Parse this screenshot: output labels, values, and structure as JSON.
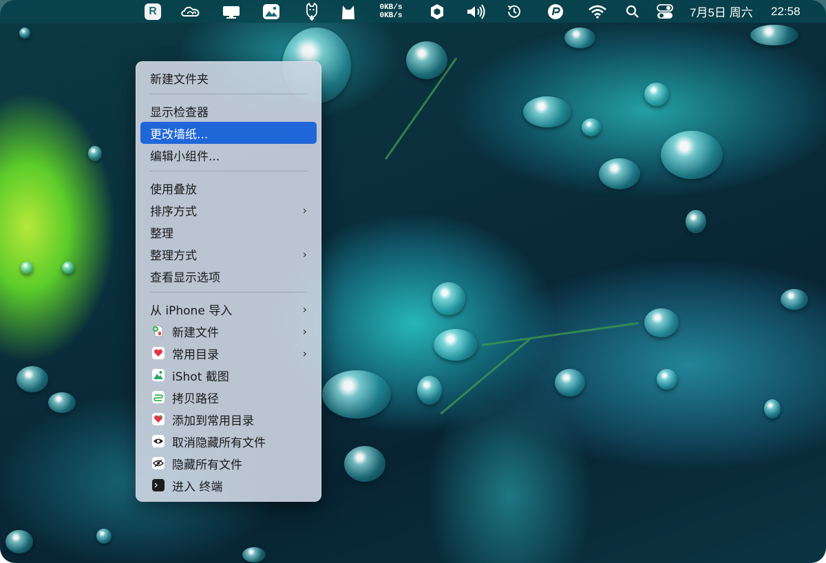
{
  "menubar": {
    "app_icon_letter": "R",
    "network": {
      "up": "0KB/s",
      "down": "0KB/s"
    },
    "clock": {
      "date": "7月5日 周六",
      "time": "22:58"
    },
    "icons": [
      "reeder-icon",
      "creative-cloud-icon",
      "display-icon",
      "image-icon",
      "alpaca-icon",
      "cat-icon",
      "network-speed",
      "hexagon-icon",
      "volume-icon",
      "time-machine-icon",
      "pockity-icon",
      "wifi-icon",
      "spotlight-icon",
      "control-center-icon"
    ]
  },
  "context_menu": {
    "items": [
      {
        "label": "新建文件夹"
      },
      {
        "label": "显示检查器"
      },
      {
        "label": "更改墙纸...",
        "selected": true
      },
      {
        "label": "编辑小组件..."
      },
      {
        "label": "使用叠放"
      },
      {
        "label": "排序方式",
        "submenu": true
      },
      {
        "label": "整理"
      },
      {
        "label": "整理方式",
        "submenu": true
      },
      {
        "label": "查看显示选项"
      },
      {
        "label": "从 iPhone 导入",
        "submenu": true
      },
      {
        "label": "新建文件",
        "icon": "new-file-icon",
        "submenu": true
      },
      {
        "label": "常用目录",
        "icon": "heart-folder-icon",
        "submenu": true
      },
      {
        "label": "iShot 截图",
        "icon": "ishot-icon"
      },
      {
        "label": "拷贝路径",
        "icon": "copy-path-icon"
      },
      {
        "label": "添加到常用目录",
        "icon": "add-favorite-icon"
      },
      {
        "label": "取消隐藏所有文件",
        "icon": "eye-icon"
      },
      {
        "label": "隐藏所有文件",
        "icon": "eye-slash-icon"
      },
      {
        "label": "进入 终端",
        "icon": "terminal-icon"
      }
    ],
    "chevron": "›"
  },
  "colors": {
    "selection": "#1f66d9",
    "menubar": "#0a4650"
  }
}
